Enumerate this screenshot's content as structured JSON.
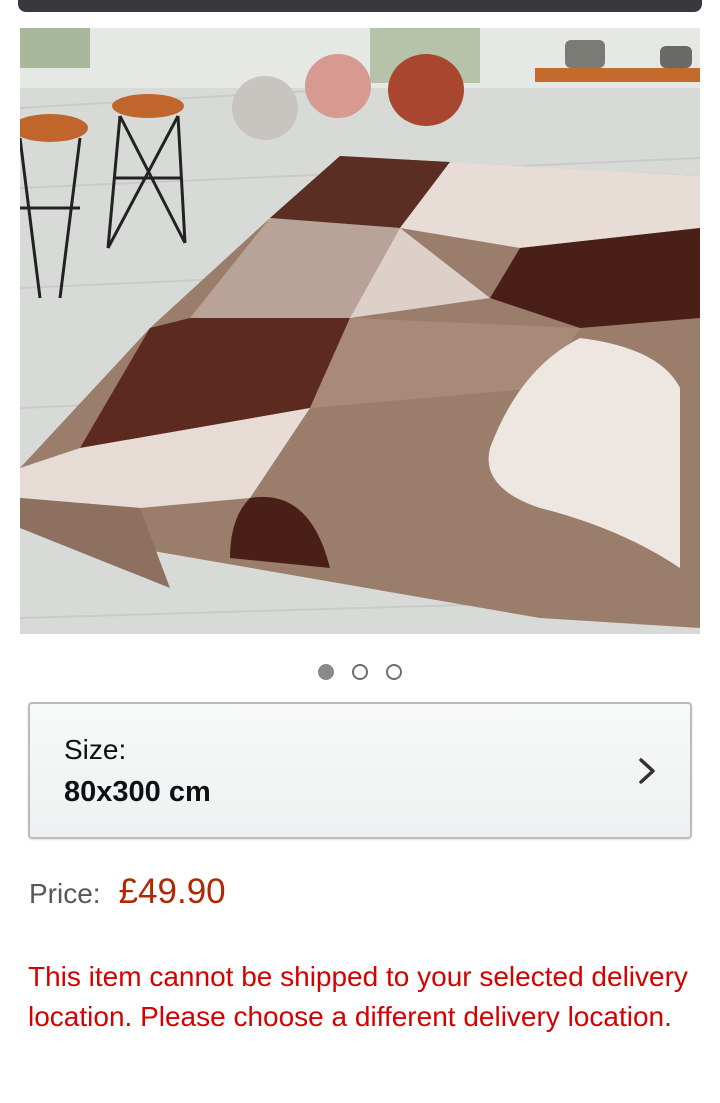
{
  "carousel": {
    "image_alt": "Brown and beige geometric pattern rug",
    "dot_count": 3,
    "active_index": 0
  },
  "size_selector": {
    "label": "Size:",
    "value": "80x300 cm"
  },
  "price": {
    "label": "Price:",
    "value": "£49.90",
    "color": "#B12704"
  },
  "shipping": {
    "message": "This item cannot be shipped to your selected delivery location. Please choose a different delivery location.",
    "color": "#D60000"
  },
  "icons": {
    "chevron": "chevron-right-icon"
  }
}
